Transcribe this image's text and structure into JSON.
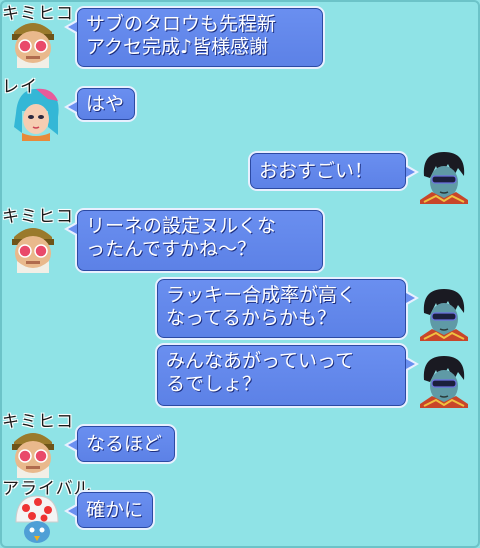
{
  "chat": {
    "messages": [
      {
        "speaker": "キミヒコ",
        "text": "サブのタロウも先程新\nアクセ完成♪皆様感謝"
      },
      {
        "speaker": "レイ",
        "text": "はや"
      },
      {
        "speaker": "",
        "text": "おおすごい！"
      },
      {
        "speaker": "キミヒコ",
        "text": "リーネの設定ヌルくな\nったんですかね～？"
      },
      {
        "speaker": "",
        "text": "ラッキー合成率が高く\nなってるからかも？"
      },
      {
        "speaker": "",
        "text": "みんなあがっていって\nるでしょ？"
      },
      {
        "speaker": "キミヒコ",
        "text": "なるほど"
      },
      {
        "speaker": "アライバル",
        "text": "確かに"
      }
    ]
  },
  "colors": {
    "background": "#8fe3e6",
    "bubble": "#6a8ff0",
    "bubble_border": "#e8f0ff"
  },
  "icons": {
    "kimihiko": "old-man-goggles-avatar-icon",
    "rei": "blue-hair-girl-avatar-icon",
    "self": "dark-hair-masked-avatar-icon",
    "arrival": "red-spotted-mushroom-hat-avatar-icon"
  }
}
